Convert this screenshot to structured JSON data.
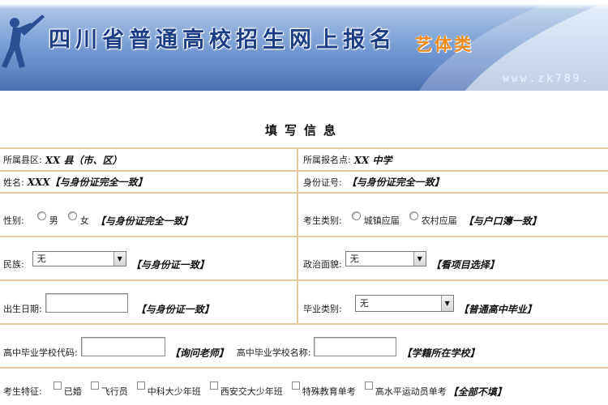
{
  "banner": {
    "title": "四川省普通高校招生网上报名",
    "subtitle": "艺体类",
    "url": "www.zk789."
  },
  "form_title": "填写信息",
  "rows": {
    "county": {
      "label": "所属县区:",
      "value": "XX 县（市、区）"
    },
    "site": {
      "label": "所属报名点:",
      "value": "XX 中学"
    },
    "name": {
      "label": "姓名:",
      "value": "XXX【与身份证完全一致】"
    },
    "idno": {
      "label": "身份证号:",
      "note": "【与身份证完全一致】"
    },
    "gender": {
      "label": "性别:",
      "opt_male": "男",
      "opt_female": "女",
      "note": "【与身份证完全一致】"
    },
    "category": {
      "label": "考生类别:",
      "opt_urban": "城镇应届",
      "opt_rural": "农村应届",
      "note": "【与户口簿一致】"
    },
    "nation": {
      "label": "民族:",
      "selected": "无",
      "note": "【与身份证一致】"
    },
    "politics": {
      "label": "政治面貌:",
      "selected": "无",
      "note": "【看项目选择】"
    },
    "birth": {
      "label": "出生日期:",
      "note": "【与身份证一致】"
    },
    "grad": {
      "label": "毕业类别:",
      "selected": "无",
      "note": "【普通高中毕业】"
    },
    "school_code": {
      "label": "高中毕业学校代码:",
      "note": "【询问老师】"
    },
    "school_name": {
      "label": "高中毕业学校名称:",
      "note": "【学籍所在学校】"
    },
    "features": {
      "label": "考生特征:",
      "options": [
        "已婚",
        "飞行员",
        "中科大少年班",
        "西安交大少年班",
        "特殊教育单考",
        "高水平运动员单考"
      ],
      "note": "【全部不填】"
    }
  },
  "colors": {
    "border": "#e6c9a0",
    "banner_blue": "#3f66aa",
    "title_blue": "#1b3f86",
    "accent_orange": "#f08a1c"
  },
  "icons": {
    "select_arrow": "triangle-down-icon"
  }
}
